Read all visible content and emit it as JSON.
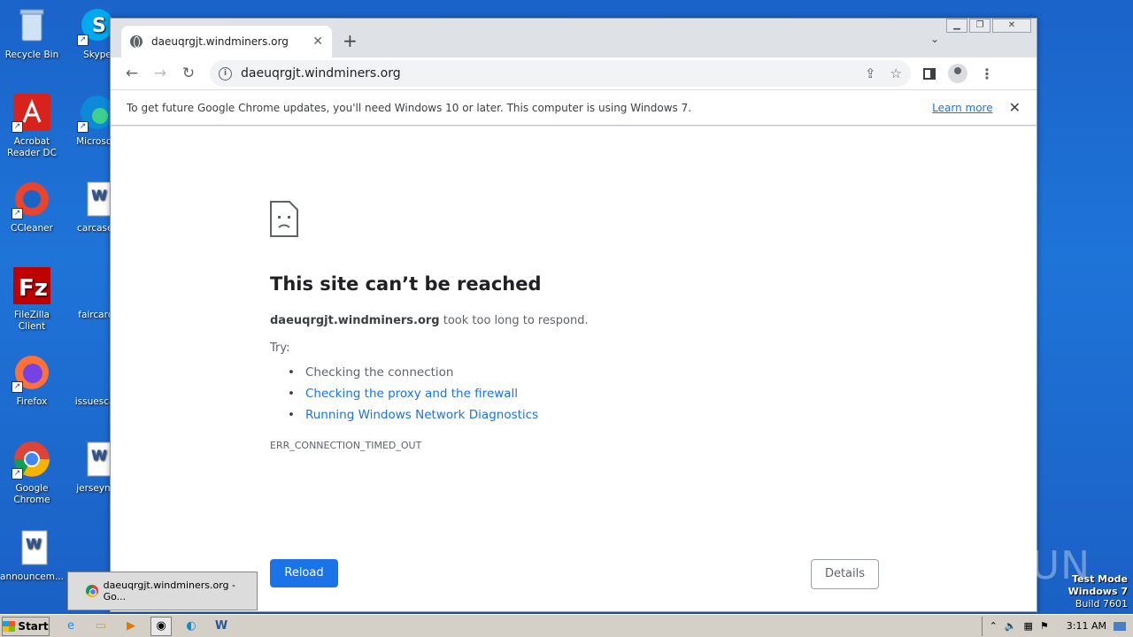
{
  "desktop": {
    "icons": [
      {
        "label": "Recycle Bin"
      },
      {
        "label": "Skype"
      },
      {
        "label": "Acrobat Reader DC"
      },
      {
        "label": "Microsoft"
      },
      {
        "label": "CCleaner"
      },
      {
        "label": "carcases"
      },
      {
        "label": "FileZilla Client"
      },
      {
        "label": "faircard."
      },
      {
        "label": "Firefox"
      },
      {
        "label": "issuescall"
      },
      {
        "label": "Google Chrome"
      },
      {
        "label": "jerseyms"
      },
      {
        "label": "announcem..."
      }
    ]
  },
  "browser": {
    "tab_title": "daeuqrgjt.windminers.org",
    "url": "daeuqrgjt.windminers.org",
    "infobar": {
      "message": "To get future Google Chrome updates, you'll need Windows 10 or later. This computer is using Windows 7.",
      "learn_more": "Learn more"
    },
    "error": {
      "title": "This site can’t be reached",
      "host": "daeuqrgjt.windminers.org",
      "desc_suffix": " took too long to respond.",
      "try_label": "Try:",
      "suggestions": [
        "Checking the connection",
        "Checking the proxy and the firewall",
        "Running Windows Network Diagnostics"
      ],
      "code": "ERR_CONNECTION_TIMED_OUT",
      "reload": "Reload",
      "details": "Details"
    }
  },
  "watermark": "ANY RUN",
  "test_mode": {
    "line1": "Test Mode",
    "line2": "Windows 7",
    "line3": "Build 7601"
  },
  "taskbar": {
    "start": "Start",
    "preview_title": "daeuqrgjt.windminers.org - Go...",
    "clock": "3:11 AM"
  }
}
